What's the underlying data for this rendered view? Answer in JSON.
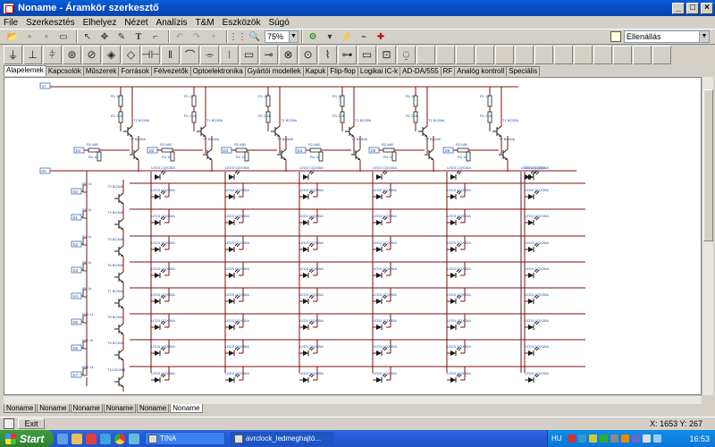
{
  "window": {
    "title": "Noname - Áramkör szerkesztő"
  },
  "menu": [
    "File",
    "Szerkesztés",
    "Elhelyez",
    "Nézet",
    "Analízis",
    "T&M",
    "Eszközök",
    "Súgó"
  ],
  "toolbar": {
    "zoom": "75%",
    "mode": "Ellenállás"
  },
  "category_tabs": [
    "Alapelemek",
    "Kapcsolók",
    "Műszerek",
    "Források",
    "Félvezetők",
    "Optoelektronika",
    "Gyártói modellek",
    "Kapuk",
    "Flip-flop",
    "Logikai IC-k",
    "AD-DA/555",
    "RF",
    "Analóg kontroll",
    "Speciális"
  ],
  "doc_tabs": [
    "Noname",
    "Noname",
    "Noname",
    "Noname",
    "Noname",
    "Noname"
  ],
  "status": {
    "exit_label": "Exit",
    "coords": "X: 1653  Y: 267"
  },
  "schematic": {
    "column_labels": {
      "r1": "R1 1k",
      "r12": "R1 2,2k",
      "t1": "T1 BC556",
      "r2": "R2 680",
      "r4": "R4 1k",
      "t2": "T2 BC846"
    },
    "led_label": "LED3 CQX35A",
    "row_labels": {
      "transistors": [
        "T3 BC846",
        "T4 BC846",
        "T5 BC846",
        "T6 BC846",
        "T7 BC846",
        "T8 BC846",
        "T9 BC846",
        "T10 BC846"
      ],
      "resistors": [
        "R5 1k",
        "R6 1k",
        "R7 1k",
        "R8 1k",
        "R9 1k",
        "R10 1k",
        "R11 1k",
        "R12 1k"
      ]
    },
    "ports": {
      "vcc": "V+",
      "gnd": "0V",
      "cols": [
        "D1",
        "D2",
        "D3",
        "D4",
        "D5",
        "D6"
      ],
      "rows": [
        "S0",
        "S1",
        "S2",
        "S3",
        "S4",
        "S5",
        "S6",
        "S7"
      ]
    }
  },
  "taskbar": {
    "start": "Start",
    "items": [
      "TINA",
      "avrclock_ledmeghajtó..."
    ],
    "language": "HU",
    "clock": "16:53"
  }
}
